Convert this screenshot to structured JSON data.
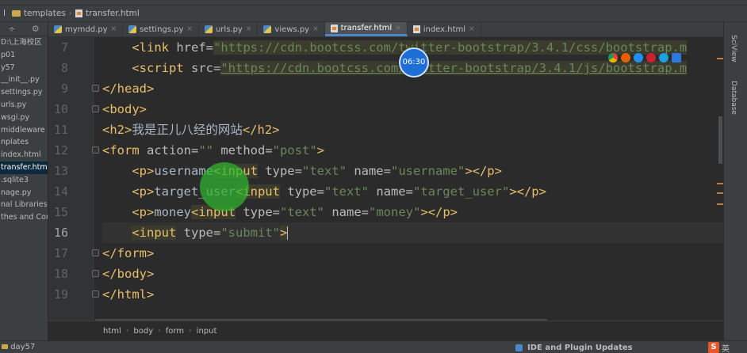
{
  "navbar": {
    "folder": "templates",
    "file": "transfer.html",
    "left_prefix": "l"
  },
  "sidebar": {
    "items": [
      {
        "label": "D:\\上海校区"
      },
      {
        "label": "p01"
      },
      {
        "label": "y57"
      },
      {
        "label": "__init__.py"
      },
      {
        "label": "settings.py"
      },
      {
        "label": "urls.py"
      },
      {
        "label": "wsgi.py"
      },
      {
        "label": "middleware"
      },
      {
        "label": "nplates"
      },
      {
        "label": "index.html"
      },
      {
        "label": "transfer.html"
      },
      {
        "label": ".sqlite3"
      },
      {
        "label": "nage.py"
      },
      {
        "label": "nal Libraries"
      },
      {
        "label": "thes and Cons"
      }
    ]
  },
  "tabs": [
    {
      "label": "mymdd.py",
      "icon": "python-file-icon"
    },
    {
      "label": "settings.py",
      "icon": "python-file-icon"
    },
    {
      "label": "urls.py",
      "icon": "python-file-icon"
    },
    {
      "label": "views.py",
      "icon": "python-file-icon"
    },
    {
      "label": "transfer.html",
      "icon": "html-file-icon",
      "active": true
    },
    {
      "label": "index.html",
      "icon": "html-file-icon"
    }
  ],
  "editor": {
    "line_numbers": [
      "7",
      "8",
      "9",
      "10",
      "11",
      "12",
      "13",
      "14",
      "15",
      "16",
      "17",
      "18",
      "19"
    ],
    "current_line": "16",
    "lines": {
      "l7": {
        "open": "<link ",
        "attr": "href=",
        "value": "\"https://cdn.bootcss.com/twitter-bootstrap/3.4.1/css/bootstrap.m"
      },
      "l8": {
        "open": "<script ",
        "attr": "src=",
        "value": "\"https://cdn.bootcss.com/twitter-bootstrap/3.4.1/js/bootstrap.m"
      },
      "l9": {
        "tag": "</head>"
      },
      "l10": {
        "tag": "<body>"
      },
      "l11": {
        "open": "<h2>",
        "text": "我是正儿八经的网站",
        "close": "</h2>"
      },
      "l12": {
        "open": "<form ",
        "attr1": "action=",
        "val1": "\"\"",
        "attr2": " method=",
        "val2": "\"post\"",
        "close": ">"
      },
      "l13": {
        "open": "<p>",
        "text": "username",
        "input": "<input",
        "attr1": " type=",
        "val1": "\"text\"",
        "attr2": " name=",
        "val2": "\"username\"",
        "close": "></p>"
      },
      "l14": {
        "open": "<p>",
        "text": "target_user",
        "input": "<input",
        "attr1": " type=",
        "val1": "\"text\"",
        "attr2": " name=",
        "val2": "\"target_user\"",
        "close": "></p>"
      },
      "l15": {
        "open": "<p>",
        "text": "money",
        "input": "<input",
        "attr1": " type=",
        "val1": "\"text\"",
        "attr2": " name=",
        "val2": "\"money\"",
        "close": "></p>"
      },
      "l16": {
        "input": "<input",
        "attr1": " type=",
        "val1": "\"submit\"",
        "close": ">"
      },
      "l17": {
        "tag": "</form>"
      },
      "l18": {
        "tag": "</body>"
      },
      "l19": {
        "tag": "</html>"
      }
    }
  },
  "right_tools": {
    "sciview": "SciView",
    "database": "Database"
  },
  "breadcrumb": [
    "html",
    "body",
    "form",
    "input"
  ],
  "status": {
    "project": "day57",
    "notification": "IDE and Plugin Updates",
    "ime_char": "英"
  },
  "overlay": {
    "clock_time": "06:30"
  },
  "colors": {
    "editor_bg": "#2b2b2b",
    "tag": "#e8bf6a",
    "string": "#6a8759",
    "attribute": "#bababa",
    "text": "#a9b7c6",
    "accent": "#4a88c7"
  }
}
